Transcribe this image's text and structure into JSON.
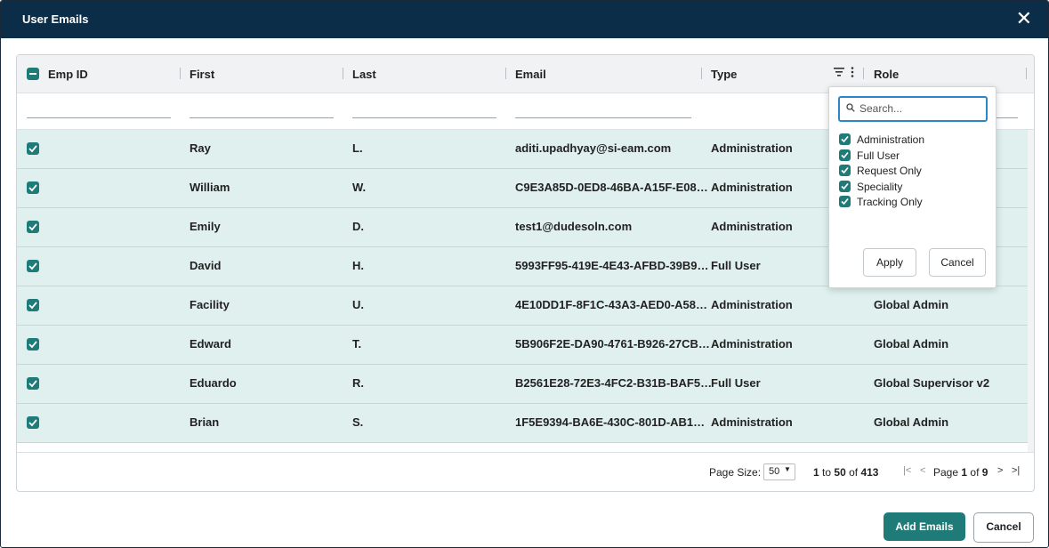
{
  "dialog": {
    "title": "User Emails",
    "close_icon": "close-icon"
  },
  "columns": {
    "emp_id": "Emp ID",
    "first": "First",
    "last": "Last",
    "email": "Email",
    "type": "Type",
    "role": "Role"
  },
  "rows": [
    {
      "first": "Ray",
      "last": "L.",
      "email": "aditi.upadhyay@si-eam.com",
      "type": "Administration",
      "role": ""
    },
    {
      "first": "William",
      "last": "W.",
      "email": "C9E3A85D-0ED8-46BA-A15F-E08…",
      "type": "Administration",
      "role": ""
    },
    {
      "first": "Emily",
      "last": "D.",
      "email": "test1@dudesoln.com",
      "type": "Administration",
      "role": ""
    },
    {
      "first": "David",
      "last": "H.",
      "email": "5993FF95-419E-4E43-AFBD-39B9…",
      "type": "Full User",
      "role": ""
    },
    {
      "first": "Facility",
      "last": "U.",
      "email": "4E10DD1F-8F1C-43A3-AED0-A58…",
      "type": "Administration",
      "role": "Global Admin"
    },
    {
      "first": "Edward",
      "last": "T.",
      "email": "5B906F2E-DA90-4761-B926-27CB…",
      "type": "Administration",
      "role": "Global Admin"
    },
    {
      "first": "Eduardo",
      "last": "R.",
      "email": "B2561E28-72E3-4FC2-B31B-BAF5…",
      "type": "Full User",
      "role": "Global Supervisor v2"
    },
    {
      "first": "Brian",
      "last": "S.",
      "email": "1F5E9394-BA6E-430C-801D-AB1…",
      "type": "Administration",
      "role": "Global Admin"
    }
  ],
  "filter_popup": {
    "search_placeholder": "Search...",
    "options": [
      "Administration",
      "Full User",
      "Request Only",
      "Speciality",
      "Tracking Only"
    ],
    "apply_label": "Apply",
    "cancel_label": "Cancel"
  },
  "footer": {
    "page_size_label": "Page Size:",
    "page_size_value": "50",
    "range_from": "1",
    "range_to_word": "to",
    "range_to": "50",
    "range_of_word": "of",
    "total": "413",
    "page_word": "Page",
    "page_current": "1",
    "page_of_word": "of",
    "page_total": "9"
  },
  "actions": {
    "add_label": "Add Emails",
    "cancel_label": "Cancel"
  },
  "colors": {
    "header": "#0c2d48",
    "accent": "#1e7b78",
    "row_selected": "#dff0ef",
    "focus": "#2b87c8"
  }
}
